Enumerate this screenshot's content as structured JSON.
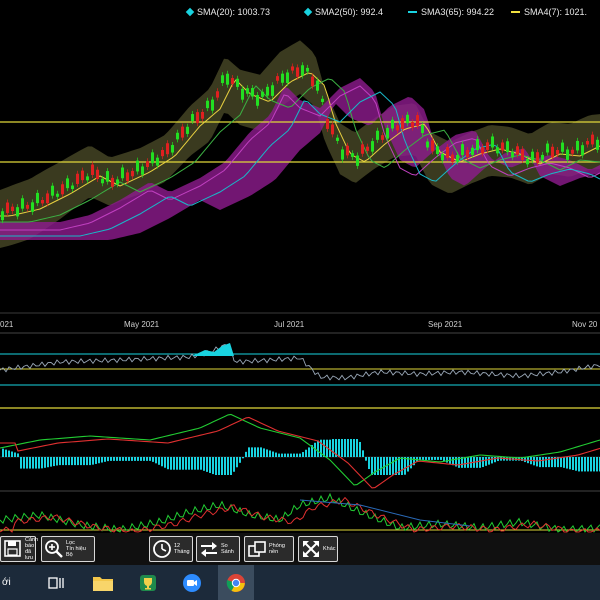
{
  "legend": [
    {
      "label": "SMA(20): 1003.73",
      "marker": "diamond",
      "color": "#19d3e0"
    },
    {
      "label": "SMA2(50): 992.4",
      "marker": "diamond",
      "color": "#19d3e0"
    },
    {
      "label": "SMA3(65): 994.22",
      "marker": "dash",
      "color": "#19d3e0"
    },
    {
      "label": "SMA4(7): 1021.",
      "marker": "dash",
      "color": "#f0e040"
    }
  ],
  "x_axis": {
    "labels": [
      "021",
      "May 2021",
      "Jul 2021",
      "Sep 2021",
      "Nov 20"
    ]
  },
  "colors": {
    "up": "#22e022",
    "down": "#e02020",
    "bands": "#4d4d2a",
    "cloud": "#8e1c8e",
    "level": "#e0d83a",
    "rsi": "#19d3e0"
  },
  "toolbar": [
    {
      "id": "save",
      "label": "Cảnh\nbáo\nđã lưu",
      "icon": "save-icon"
    },
    {
      "id": "filter",
      "label": "Lọc\nTín hiệu\nBộ",
      "icon": "magnifier-plus-icon"
    },
    {
      "id": "time",
      "label": "12\nTháng",
      "icon": "clock-icon"
    },
    {
      "id": "compare",
      "label": "So\nSánh",
      "icon": "swap-arrows-icon"
    },
    {
      "id": "zoom",
      "label": "Phóng\nnền",
      "icon": "overlap-squares-icon"
    },
    {
      "id": "other",
      "label": "Khác",
      "icon": "expand-arrows-icon"
    }
  ],
  "taskbar": {
    "first_label": "ới"
  }
}
